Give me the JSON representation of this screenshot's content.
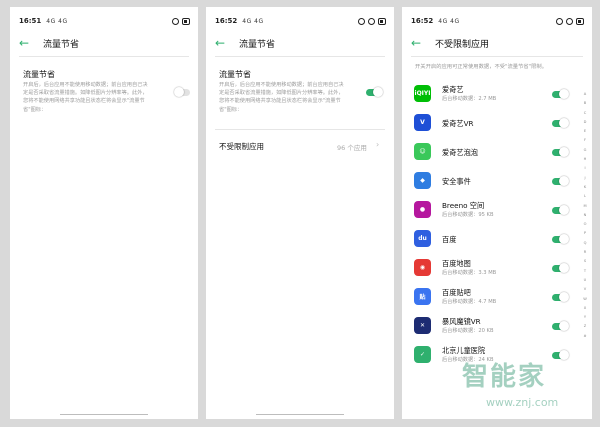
{
  "colors": {
    "accent": "#2fb06e",
    "background": "#d9d9d9"
  },
  "phone1": {
    "time": "16:51",
    "signal": "4G 4G",
    "back_icon": "back-arrow-icon",
    "title": "流量节省",
    "section_title": "流量节省",
    "description": "开启后，后台应用不能使用移动数据；前台应用自己决定是否采取省流量措施。如降低图片分辨率等。此外，您将不能使用网络共享功能且状态栏将会显示\"流量节省\"图标：",
    "toggle_state": "off"
  },
  "phone2": {
    "time": "16:52",
    "signal": "4G 4G",
    "back_icon": "back-arrow-icon",
    "title": "流量节省",
    "section_title": "流量节省",
    "description": "开启后，后台应用不能使用移动数据；前台应用自己决定是否采取省流量措施，如降低图片分辨率等。此外，您将不能使用网络共享功能且状态栏将会显示\"流量节省\"图标：",
    "toggle_state": "on",
    "row_label": "不受限制应用",
    "row_value": "96 个应用"
  },
  "phone3": {
    "time": "16:52",
    "signal": "4G 4G",
    "back_icon": "back-arrow-icon",
    "title": "不受限制应用",
    "list_header": "开关开启的应用可正常使用数据，不受\"流量节省\"限制。",
    "alphabet": [
      "A",
      "B",
      "C",
      "D",
      "E",
      "F",
      "G",
      "H",
      "I",
      "J",
      "K",
      "L",
      "M",
      "N",
      "O",
      "P",
      "Q",
      "R",
      "S",
      "T",
      "U",
      "V",
      "W",
      "X",
      "Y",
      "Z",
      "#"
    ],
    "apps": [
      {
        "name": "爱奇艺",
        "sub": "后台移动数据：2.7 MB",
        "icon": "iqiyi-icon",
        "color": "#00be06",
        "glyph": "iQIYI"
      },
      {
        "name": "爱奇艺VR",
        "sub": "",
        "icon": "iqiyi-vr-icon",
        "color": "#1e4fd6",
        "glyph": "V"
      },
      {
        "name": "爱奇艺泡泡",
        "sub": "",
        "icon": "iqiyi-paopao-icon",
        "color": "#3ac85a",
        "glyph": "☺"
      },
      {
        "name": "安全事件",
        "sub": "",
        "icon": "security-event-icon",
        "color": "#2f7de1",
        "glyph": "◆"
      },
      {
        "name": "Breeno 空间",
        "sub": "后台移动数据：95 KB",
        "icon": "breeno-space-icon",
        "color": "#b5179e",
        "glyph": "●"
      },
      {
        "name": "百度",
        "sub": "",
        "icon": "baidu-icon",
        "color": "#2f5fe0",
        "glyph": "du"
      },
      {
        "name": "百度地图",
        "sub": "后台移动数据：3.3 MB",
        "icon": "baidu-map-icon",
        "color": "#e53935",
        "glyph": "◉"
      },
      {
        "name": "百度贴吧",
        "sub": "后台移动数据：4.7 MB",
        "icon": "baidu-tieba-icon",
        "color": "#3a74f0",
        "glyph": "贴"
      },
      {
        "name": "暴风魔镜VR",
        "sub": "后台移动数据：20 KB",
        "icon": "baofeng-vr-icon",
        "color": "#1d2c73",
        "glyph": "✕"
      },
      {
        "name": "北京儿童医院",
        "sub": "后台移动数据：24 KB",
        "icon": "beijing-children-hospital-icon",
        "color": "#2fb06e",
        "glyph": "✓"
      }
    ]
  },
  "watermark": {
    "text": "智能家",
    "url": "www.znj.com"
  }
}
